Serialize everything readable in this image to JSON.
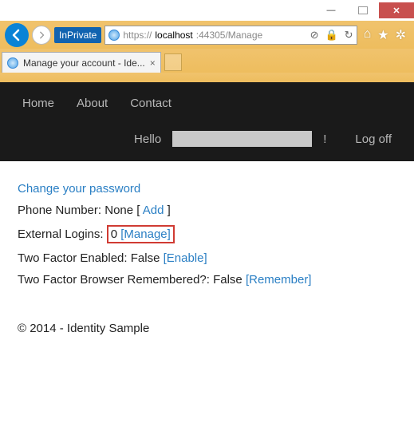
{
  "window": {
    "min": "—",
    "max": "",
    "close": "✕"
  },
  "chrome": {
    "inprivate_label": "InPrivate",
    "url_proto": "https://",
    "url_host": "localhost",
    "url_path": ":44305/Manage",
    "refresh_icon": "↻",
    "lock_icon": "🔒",
    "stop_icon": "⊘",
    "home_icon": "⌂",
    "star_icon": "★",
    "gear_icon": "✲"
  },
  "tab": {
    "title": "Manage your account - Ide...",
    "close": "×"
  },
  "nav": {
    "home": "Home",
    "about": "About",
    "contact": "Contact",
    "hello": "Hello",
    "excl": "!",
    "logoff": "Log off"
  },
  "body": {
    "change_pw": "Change your password",
    "phone_label": "Phone Number: ",
    "phone_value": "None",
    "phone_bracket_open": " [ ",
    "phone_add": "Add",
    "phone_bracket_close": " ]",
    "ext_label": "External Logins:",
    "ext_count": "0",
    "ext_manage": "[Manage]",
    "tfe_label": "Two Factor Enabled: ",
    "tfe_value": "False",
    "tfe_link": "[Enable]",
    "tfb_label": "Two Factor Browser Remembered?: ",
    "tfb_value": "False",
    "tfb_link": "[Remember]"
  },
  "footer": {
    "text": "© 2014 - Identity Sample"
  }
}
